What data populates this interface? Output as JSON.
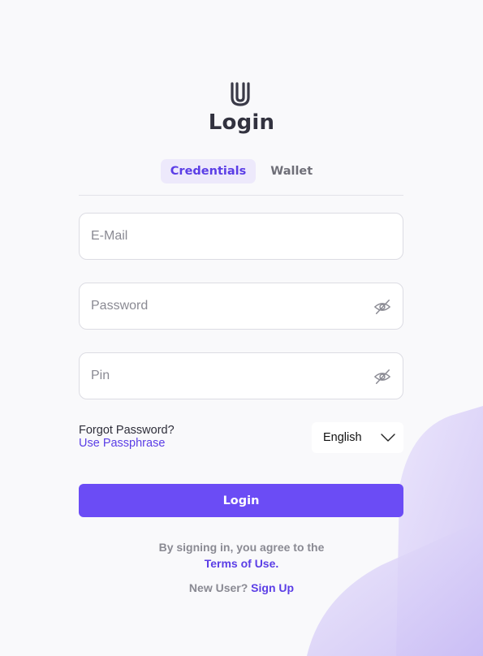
{
  "header": {
    "title": "Login",
    "logo_icon": "u-logo-icon"
  },
  "tabs": [
    {
      "label": "Credentials",
      "active": true
    },
    {
      "label": "Wallet",
      "active": false
    }
  ],
  "form": {
    "email": {
      "value": "",
      "placeholder": "E-Mail"
    },
    "password": {
      "value": "",
      "placeholder": "Password",
      "toggle_icon": "eye-off-icon"
    },
    "pin": {
      "value": "",
      "placeholder": "Pin",
      "toggle_icon": "eye-off-icon"
    }
  },
  "links": {
    "forgot_label": "Forgot Password?",
    "passphrase_label": "Use Passphrase"
  },
  "language": {
    "selected": "English",
    "icon": "chevron-down-icon"
  },
  "login_button": "Login",
  "footer": {
    "terms_text": "By signing in, you agree to the",
    "terms_link": "Terms of Use.",
    "new_user_text": "New User?",
    "signup_link": "Sign Up"
  },
  "colors": {
    "accent": "#6b4cf5",
    "accent_text": "#5b3ee6",
    "tab_active_bg": "#ede9fb",
    "background": "#f9f9fb"
  }
}
